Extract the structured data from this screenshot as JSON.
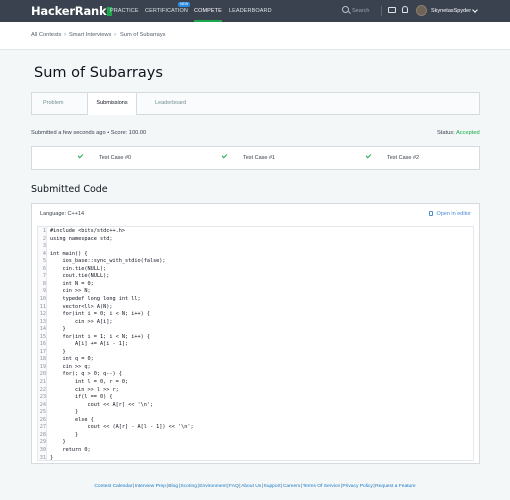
{
  "nav": {
    "logo": "HackerRank",
    "items": [
      "PRACTICE",
      "CERTIFICATION",
      "COMPETE",
      "LEADERBOARD"
    ],
    "new_badge": "NEW",
    "search_placeholder": "Search",
    "username": "SkynetasSpyder"
  },
  "breadcrumb": [
    "All Contests",
    "Smart Interviews",
    "Sum of Subarrays"
  ],
  "page_title": "Sum of Subarrays",
  "tabs": [
    "Problem",
    "Submissions",
    "Leaderboard"
  ],
  "submission": {
    "info": "Submitted a few seconds ago • Score: 100.00",
    "status_label": "Status:",
    "status_value": "Accepted"
  },
  "test_cases": [
    "Test Case #0",
    "Test Case #1",
    "Test Case #2"
  ],
  "submitted_code": {
    "heading": "Submitted Code",
    "language": "Language: C++14",
    "open_in_editor": "Open in editor",
    "lines": [
      "#include <bits/stdc++.h>",
      "using namespace std;",
      "",
      "int main() {",
      "    ios_base::sync_with_stdio(false);",
      "    cin.tie(NULL);",
      "    cout.tie(NULL);",
      "    int N = 0;",
      "    cin >> N;",
      "    typedef long long int ll;",
      "    vector<ll> A(N);",
      "    for(int i = 0; i < N; i++) {",
      "        cin >> A[i];",
      "    }",
      "    for(int i = 1; i < N; i++) {",
      "        A[i] += A[i - 1];",
      "    }",
      "    int q = 0;",
      "    cin >> q;",
      "    for(; q > 0; q--) {",
      "        int l = 0, r = 0;",
      "        cin >> l >> r;",
      "        if(l == 0) {",
      "            cout << A[r] << '\\n';",
      "        }",
      "        else {",
      "            cout << (A[r] - A[l - 1]) << '\\n';",
      "        }",
      "    }",
      "    return 0;",
      "}"
    ]
  },
  "footer": [
    "Contest Calendar",
    "Interview Prep",
    "Blog",
    "Scoring",
    "Environment",
    "FAQ",
    "About Us",
    "Support",
    "Careers",
    "Terms Of Service",
    "Privacy Policy",
    "Request a Feature"
  ],
  "colors": {
    "accent": "#1ba94c",
    "nav_bg": "#39424e",
    "link": "#1a79c7"
  }
}
